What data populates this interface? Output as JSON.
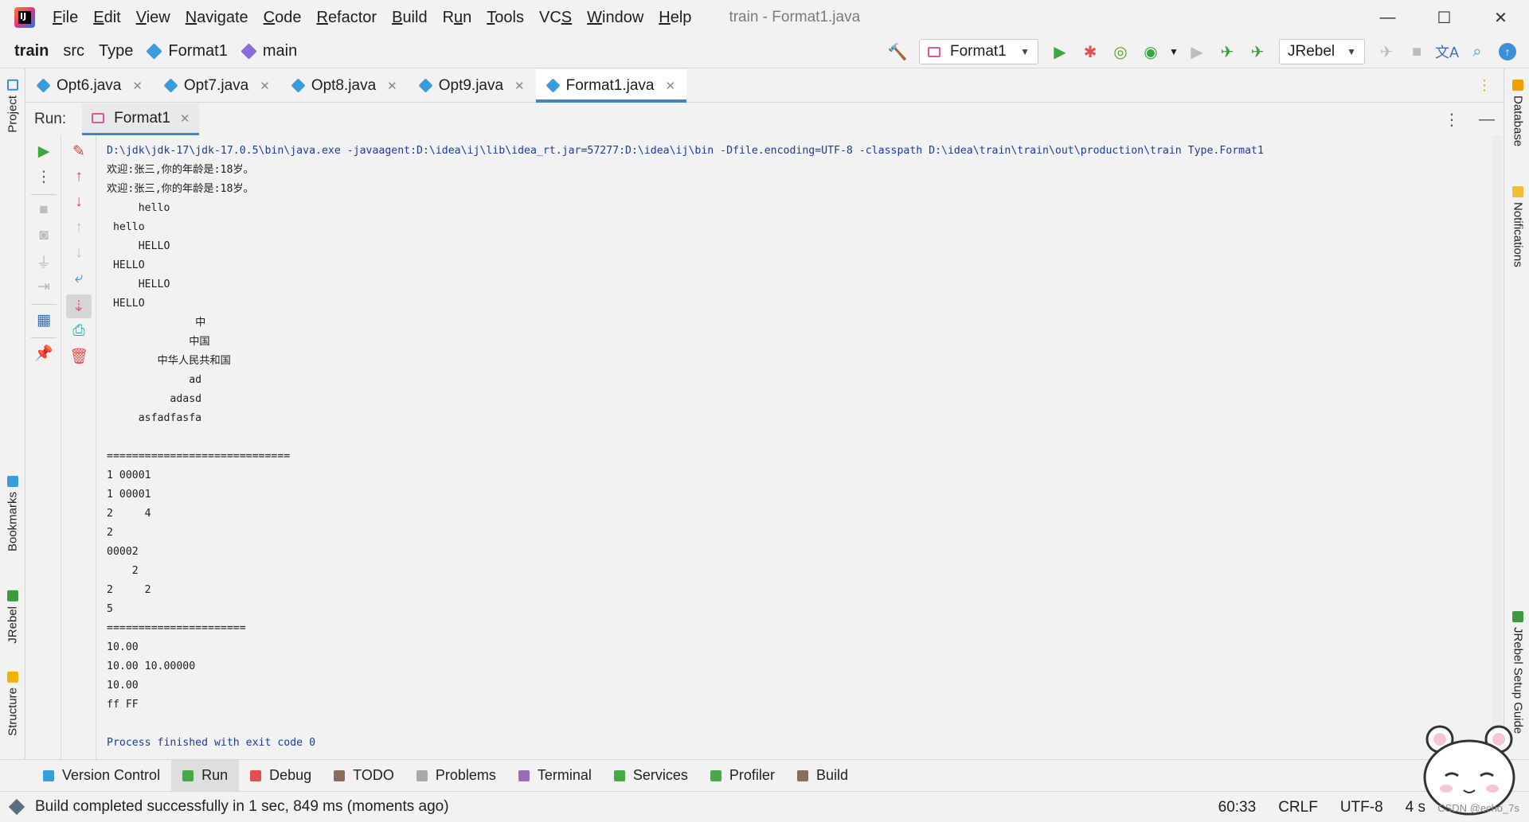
{
  "app": {
    "logo_text": "IJ",
    "window_title": "train - Format1.java",
    "menu": [
      {
        "pre": "",
        "u": "F",
        "post": "ile"
      },
      {
        "pre": "",
        "u": "E",
        "post": "dit"
      },
      {
        "pre": "",
        "u": "V",
        "post": "iew"
      },
      {
        "pre": "",
        "u": "N",
        "post": "avigate"
      },
      {
        "pre": "",
        "u": "C",
        "post": "ode"
      },
      {
        "pre": "",
        "u": "R",
        "post": "efactor"
      },
      {
        "pre": "",
        "u": "B",
        "post": "uild"
      },
      {
        "pre": "R",
        "u": "u",
        "post": "n"
      },
      {
        "pre": "",
        "u": "T",
        "post": "ools"
      },
      {
        "pre": "VC",
        "u": "S",
        "post": ""
      },
      {
        "pre": "",
        "u": "W",
        "post": "indow"
      },
      {
        "pre": "",
        "u": "H",
        "post": "elp"
      }
    ],
    "window_controls": {
      "minimize": "—",
      "maximize": "☐",
      "close": "✕"
    }
  },
  "navbar": {
    "project": "train",
    "crumbs": [
      "src",
      "Type",
      "Format1",
      "main"
    ],
    "run_config": "Format1",
    "jrebel_combo": "JRebel"
  },
  "left_tabs": [
    "Project",
    "Bookmarks",
    "JRebel",
    "Structure"
  ],
  "right_tabs": [
    "Database",
    "Notifications",
    "JRebel Setup Guide"
  ],
  "editor_tabs": [
    {
      "label": "Opt6.java",
      "active": false
    },
    {
      "label": "Opt7.java",
      "active": false
    },
    {
      "label": "Opt8.java",
      "active": false
    },
    {
      "label": "Opt9.java",
      "active": false
    },
    {
      "label": "Format1.java",
      "active": true
    }
  ],
  "run_panel": {
    "label": "Run:",
    "tab": "Format1"
  },
  "console": {
    "lines": [
      {
        "text": "D:\\jdk\\jdk-17\\jdk-17.0.5\\bin\\java.exe -javaagent:D:\\idea\\ij\\lib\\idea_rt.jar=57277:D:\\idea\\ij\\bin -Dfile.encoding=UTF-8 -classpath D:\\idea\\train\\train\\out\\production\\train Type.Format1",
        "sys": true
      },
      {
        "text": "欢迎:张三,你的年龄是:18岁。",
        "sys": false
      },
      {
        "text": "欢迎:张三,你的年龄是:18岁。",
        "sys": false
      },
      {
        "text": "     hello",
        "sys": false
      },
      {
        "text": " hello",
        "sys": false
      },
      {
        "text": "     HELLO",
        "sys": false
      },
      {
        "text": " HELLO",
        "sys": false
      },
      {
        "text": "     HELLO",
        "sys": false
      },
      {
        "text": " HELLO",
        "sys": false
      },
      {
        "text": "              中",
        "sys": false
      },
      {
        "text": "             中国",
        "sys": false
      },
      {
        "text": "        中华人民共和国",
        "sys": false
      },
      {
        "text": "             ad",
        "sys": false
      },
      {
        "text": "          adasd",
        "sys": false
      },
      {
        "text": "     asfadfasfa",
        "sys": false
      },
      {
        "text": "",
        "sys": false
      },
      {
        "text": "=============================",
        "sys": false
      },
      {
        "text": "1 00001",
        "sys": false
      },
      {
        "text": "1 00001",
        "sys": false
      },
      {
        "text": "2     4",
        "sys": false
      },
      {
        "text": "2",
        "sys": false
      },
      {
        "text": "00002",
        "sys": false
      },
      {
        "text": "    2",
        "sys": false
      },
      {
        "text": "2     2",
        "sys": false
      },
      {
        "text": "5",
        "sys": false
      },
      {
        "text": "======================",
        "sys": false
      },
      {
        "text": "10.00",
        "sys": false
      },
      {
        "text": "10.00 10.00000",
        "sys": false
      },
      {
        "text": "10.00",
        "sys": false
      },
      {
        "text": "ff FF",
        "sys": false
      },
      {
        "text": "",
        "sys": false
      },
      {
        "text": "Process finished with exit code 0",
        "sys": true
      }
    ]
  },
  "bottom_tabs": [
    {
      "label": "Version Control",
      "icon": "branch-icon",
      "color": "#3a9ddb",
      "active": false
    },
    {
      "label": "Run",
      "icon": "run-icon",
      "color": "#4aa84a",
      "active": true
    },
    {
      "label": "Debug",
      "icon": "bug-icon",
      "color": "#e05050",
      "active": false
    },
    {
      "label": "TODO",
      "icon": "todo-icon",
      "color": "#8a6d5c",
      "active": false
    },
    {
      "label": "Problems",
      "icon": "problems-icon",
      "color": "#a8a8a8",
      "active": false
    },
    {
      "label": "Terminal",
      "icon": "terminal-icon",
      "color": "#9a6bb8",
      "active": false
    },
    {
      "label": "Services",
      "icon": "services-icon",
      "color": "#4aa84a",
      "active": false
    },
    {
      "label": "Profiler",
      "icon": "profiler-icon",
      "color": "#4aa84a",
      "active": false
    },
    {
      "label": "Build",
      "icon": "build-icon",
      "color": "#8a6d5c",
      "active": false
    }
  ],
  "status": {
    "message": "Build completed successfully in 1 sec, 849 ms (moments ago)",
    "position": "60:33",
    "line_sep": "CRLF",
    "encoding": "UTF-8",
    "indent": "4 s"
  },
  "watermark": "CSDN @echo_7s",
  "colors": {
    "accent": "#4083c9",
    "console_sys": "#1a3c9c"
  }
}
